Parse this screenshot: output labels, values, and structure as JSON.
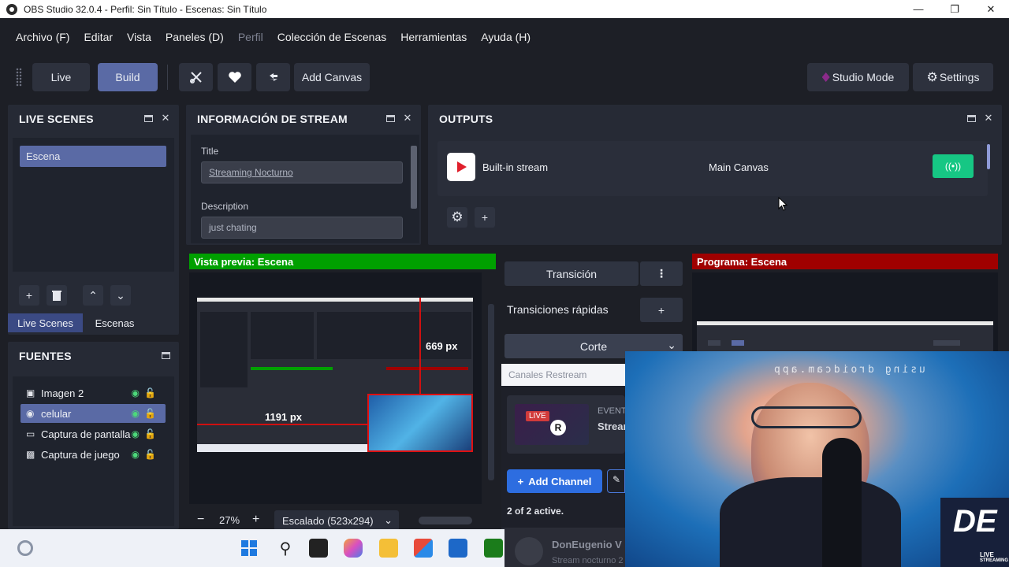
{
  "window": {
    "title": "OBS Studio 32.0.4 - Perfil: Sin Título - Escenas: Sin Título"
  },
  "menu": [
    "Archivo (F)",
    "Editar",
    "Vista",
    "Paneles (D)",
    "Perfil",
    "Colección de Escenas",
    "Herramientas",
    "Ayuda (H)"
  ],
  "toolbar": {
    "live": "Live",
    "build": "Build",
    "add_canvas": "Add Canvas",
    "studio_mode": "Studio Mode",
    "settings": "Settings"
  },
  "live_scenes": {
    "title": "LIVE SCENES",
    "items": [
      "Escena"
    ],
    "tabs": [
      "Live Scenes",
      "Escenas"
    ]
  },
  "sources": {
    "title": "FUENTES",
    "items": [
      {
        "label": "Imagen 2",
        "icon": "image-icon"
      },
      {
        "label": "celular",
        "icon": "camera-icon"
      },
      {
        "label": "Captura de pantalla",
        "icon": "monitor-icon"
      },
      {
        "label": "Captura de juego",
        "icon": "gamepad-icon"
      }
    ]
  },
  "stream_info": {
    "title": "INFORMACIÓN DE STREAM",
    "title_label": "Title",
    "title_value": "Streaming Nocturno",
    "desc_label": "Description",
    "desc_value": "just chating"
  },
  "outputs": {
    "title": "OUTPUTS",
    "row_name": "Built-in stream",
    "row_canvas": "Main Canvas"
  },
  "preview": {
    "label": "Vista previa: Escena",
    "zoom": "27%",
    "scale": "Escalado (523x294)",
    "width_px": "669 px",
    "height_px": "1191 px"
  },
  "program": {
    "label": "Programa: Escena"
  },
  "transitions": {
    "transition": "Transición",
    "quick": "Transiciones rápidas",
    "cut": "Corte"
  },
  "restream": {
    "title": "Canales Restream",
    "event_badge": "EVENT",
    "event_title": "Strear",
    "live_badge": "LIVE",
    "add_channel": "Add Channel",
    "active": "2 of 2 active.",
    "channel_name": "DonEugenio V",
    "channel_sub": "Stream nocturno 2"
  },
  "webcam": {
    "overlay_text": "using droidcam.app",
    "logo": "DE",
    "logo_sub": "LIVE",
    "logo_sub2": "STREAMING"
  },
  "colors": {
    "accent": "#5a6aa5",
    "preview_green": "#00a000",
    "program_red": "#a00000",
    "live_green": "#16c784",
    "add_channel_blue": "#2d6de0"
  }
}
